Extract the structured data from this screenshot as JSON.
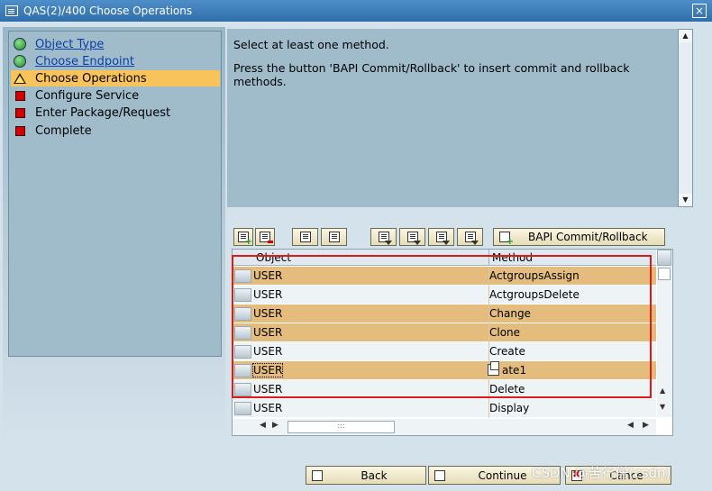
{
  "window": {
    "title": "QAS(2)/400 Choose Operations",
    "close_glyph": "×"
  },
  "steps": [
    {
      "label": "Object Type",
      "status": "done",
      "icon": "green-circle-icon"
    },
    {
      "label": "Choose Endpoint",
      "status": "done",
      "icon": "green-circle-icon"
    },
    {
      "label": "Choose Operations",
      "status": "current",
      "icon": "warning-triangle-icon"
    },
    {
      "label": "Configure Service",
      "status": "pending",
      "icon": "red-square-icon"
    },
    {
      "label": "Enter Package/Request",
      "status": "pending",
      "icon": "red-square-icon"
    },
    {
      "label": "Complete",
      "status": "pending",
      "icon": "red-square-icon"
    }
  ],
  "info": {
    "line1": "Select at least one method.",
    "line2": "Press the button 'BAPI Commit/Rollback' to insert commit and rollback methods."
  },
  "toolbar": {
    "bapi_label": "BAPI Commit/Rollback"
  },
  "table": {
    "columns": [
      "Object",
      "Method"
    ],
    "rows": [
      {
        "object": "USER",
        "method": "ActgroupsAssign",
        "selected": true
      },
      {
        "object": "USER",
        "method": "ActgroupsDelete",
        "selected": false
      },
      {
        "object": "USER",
        "method": "Change",
        "selected": true
      },
      {
        "object": "USER",
        "method": "Clone",
        "selected": true
      },
      {
        "object": "USER",
        "method": "Create",
        "selected": false
      },
      {
        "object": "USER",
        "method": "ate1",
        "selected": true
      },
      {
        "object": "USER",
        "method": "Delete",
        "selected": false
      },
      {
        "object": "USER",
        "method": "Display",
        "selected": false
      }
    ]
  },
  "buttons": {
    "back": "Back",
    "continue": "Continue",
    "cancel": "Cance"
  },
  "watermark": "CSDN @苦行僧(csdn)",
  "colors": {
    "selected_row": "#e3bc7e",
    "active_step": "#f7c35a",
    "annotation_box": "#e01919"
  }
}
